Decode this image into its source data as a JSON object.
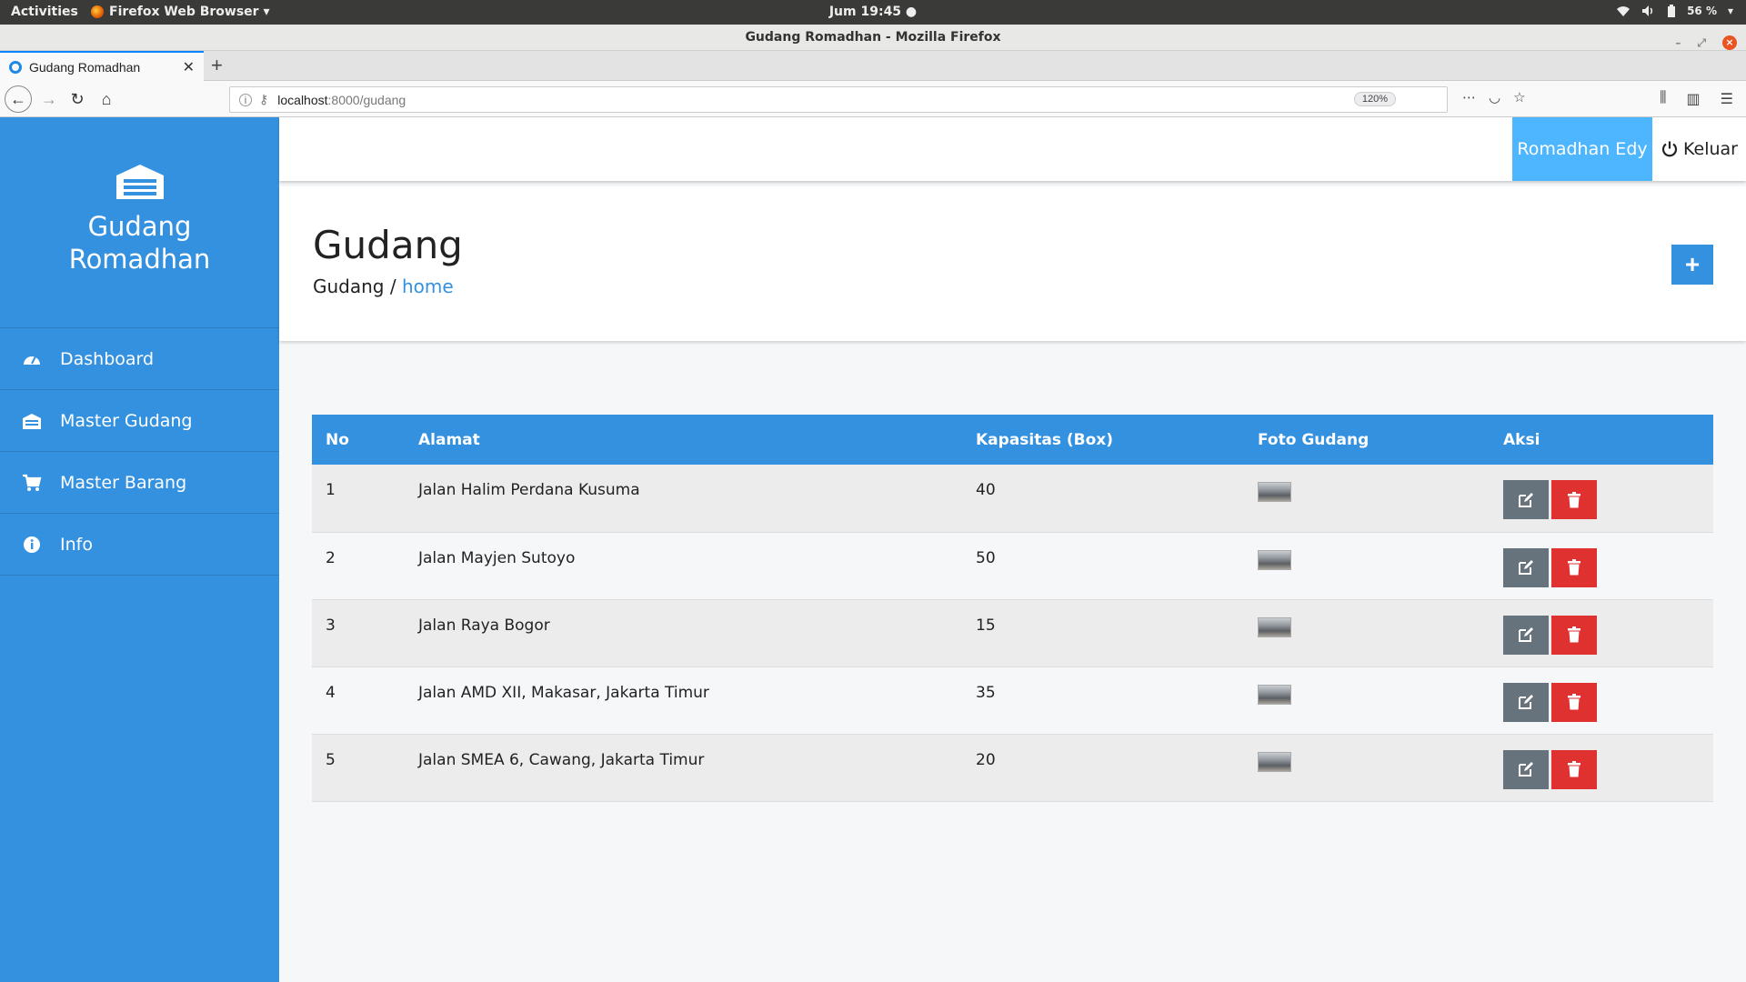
{
  "os": {
    "activities": "Activities",
    "app_menu": "Firefox Web Browser ▾",
    "clock": "Jum 19:45 ●",
    "battery": "56 %"
  },
  "browser": {
    "window_title": "Gudang Romadhan - Mozilla Firefox",
    "tab_title": "Gudang Romadhan",
    "url_host": "localhost",
    "url_path": ":8000/gudang",
    "zoom": "120%"
  },
  "sidebar": {
    "brand_line1": "Gudang",
    "brand_line2": "Romadhan",
    "items": [
      {
        "label": "Dashboard",
        "icon": "dashboard-icon"
      },
      {
        "label": "Master Gudang",
        "icon": "warehouse-icon"
      },
      {
        "label": "Master Barang",
        "icon": "cart-icon"
      },
      {
        "label": "Info",
        "icon": "info-icon"
      }
    ]
  },
  "topnav": {
    "user": "Romadhan Edy",
    "logout": "Keluar"
  },
  "header": {
    "title": "Gudang",
    "breadcrumb_current": "Gudang",
    "breadcrumb_sep": "/",
    "breadcrumb_link": "home",
    "add_label": "+"
  },
  "table": {
    "columns": [
      "No",
      "Alamat",
      "Kapasitas (Box)",
      "Foto Gudang",
      "Aksi"
    ],
    "rows": [
      {
        "no": "1",
        "alamat": "Jalan Halim Perdana Kusuma",
        "kapasitas": "40"
      },
      {
        "no": "2",
        "alamat": "Jalan Mayjen Sutoyo",
        "kapasitas": "50"
      },
      {
        "no": "3",
        "alamat": "Jalan Raya Bogor",
        "kapasitas": "15"
      },
      {
        "no": "4",
        "alamat": "Jalan AMD XII, Makasar, Jakarta Timur",
        "kapasitas": "35"
      },
      {
        "no": "5",
        "alamat": "Jalan SMEA 6, Cawang, Jakarta Timur",
        "kapasitas": "20"
      }
    ]
  },
  "colors": {
    "primary": "#3391e0",
    "user_highlight": "#4db6ff",
    "edit": "#67737c",
    "delete": "#e03131"
  }
}
